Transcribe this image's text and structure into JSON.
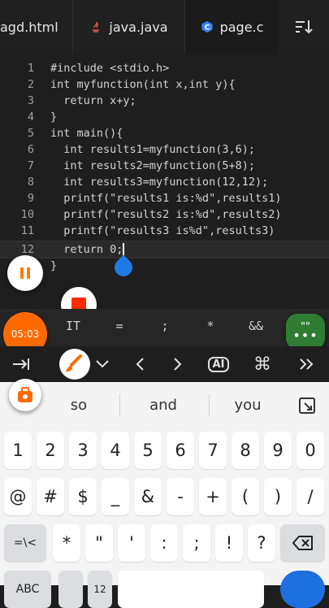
{
  "tabs": [
    {
      "label": "agd.html",
      "icon": "none",
      "active": false
    },
    {
      "label": "java.java",
      "icon": "java-icon",
      "active": false
    },
    {
      "label": "page.c",
      "icon": "c-file-icon",
      "active": true
    }
  ],
  "code_lines": [
    {
      "n": "1",
      "text": "#include <stdio.h>"
    },
    {
      "n": "2",
      "text": "int myfunction(int x,int y){"
    },
    {
      "n": "3",
      "text": "  return x+y;"
    },
    {
      "n": "4",
      "text": "}"
    },
    {
      "n": "5",
      "text": "int main(){"
    },
    {
      "n": "6",
      "text": "  int results1=myfunction(3,6);"
    },
    {
      "n": "7",
      "text": "  int results2=myfunction(5+8);"
    },
    {
      "n": "8",
      "text": "  int results3=myfunction(12,12);"
    },
    {
      "n": "9",
      "text": "  printf(\"results1 is:%d\",results1)"
    },
    {
      "n": "10",
      "text": "  printf(\"results2 is:%d\",results2)"
    },
    {
      "n": "11",
      "text": "  printf(\"results3 is%d\",results3)"
    },
    {
      "n": "12",
      "text": "  return 0;"
    },
    {
      "n": "",
      "text": "}"
    }
  ],
  "recorder": {
    "time": "05:03"
  },
  "symbols": [
    "IT",
    "=",
    ";",
    "*",
    "&&"
  ],
  "quote_key": "\"\"",
  "ai_label": "AI",
  "suggestions": [
    "so",
    "and",
    "you"
  ],
  "keys": {
    "row1": [
      "1",
      "2",
      "3",
      "4",
      "5",
      "6",
      "7",
      "8",
      "9",
      "0"
    ],
    "row2": [
      "@",
      "#",
      "$",
      "_",
      "&",
      "-",
      "+",
      "(",
      ")",
      "/"
    ],
    "row3": [
      "=\\<",
      "*",
      "\"",
      "'",
      ":",
      ";",
      "!",
      "?"
    ],
    "row4_left": "ABC",
    "row4_mid": "12"
  },
  "colors": {
    "accent": "#1e7ae6",
    "record": "#ff5a00",
    "stop": "#ff2a00",
    "green": "#2e7d32"
  }
}
